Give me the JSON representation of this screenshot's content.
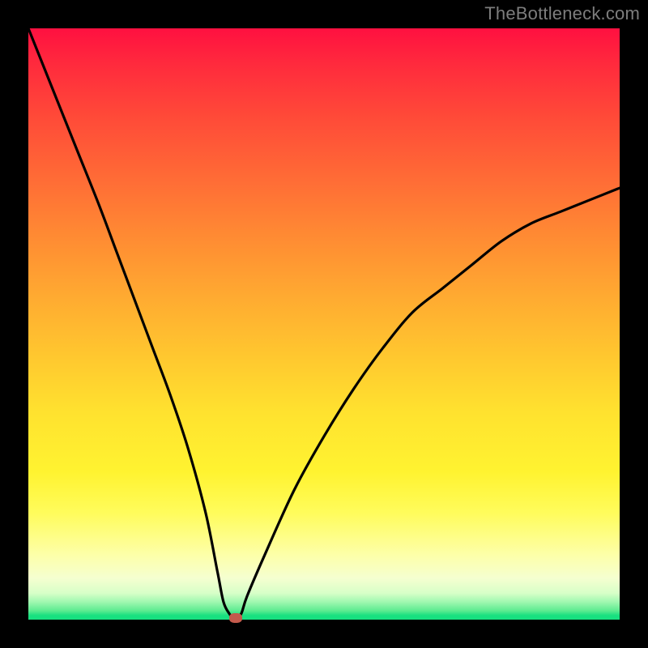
{
  "watermark": "TheBottleneck.com",
  "colors": {
    "frame": "#000000",
    "curve": "#000000",
    "marker": "#c45a4c",
    "grad_top": "#ff1040",
    "grad_bottom": "#18e080"
  },
  "chart_data": {
    "type": "line",
    "title": "",
    "xlabel": "",
    "ylabel": "",
    "xlim": [
      0,
      100
    ],
    "ylim": [
      0,
      100
    ],
    "grid": false,
    "legend": false,
    "annotations": [],
    "series": [
      {
        "name": "bottleneck-curve",
        "x": [
          0,
          4,
          8,
          12,
          15,
          18,
          21,
          24,
          27,
          30,
          32,
          33,
          34,
          35,
          36,
          37,
          40,
          45,
          50,
          55,
          60,
          65,
          70,
          75,
          80,
          85,
          90,
          95,
          100
        ],
        "values": [
          100,
          90,
          80,
          70,
          62,
          54,
          46,
          38,
          29,
          18,
          8,
          3,
          1,
          0,
          1,
          4,
          11,
          22,
          31,
          39,
          46,
          52,
          56,
          60,
          64,
          67,
          69,
          71,
          73
        ]
      }
    ],
    "marker": {
      "x": 35,
      "y": 0
    },
    "background_gradient": {
      "direction": "top-to-bottom",
      "stops": [
        {
          "pos": 0.0,
          "color": "#ff1040"
        },
        {
          "pos": 0.5,
          "color": "#ffc62f"
        },
        {
          "pos": 0.82,
          "color": "#fffc5c"
        },
        {
          "pos": 0.97,
          "color": "#a0f8b0"
        },
        {
          "pos": 1.0,
          "color": "#18e080"
        }
      ]
    }
  }
}
